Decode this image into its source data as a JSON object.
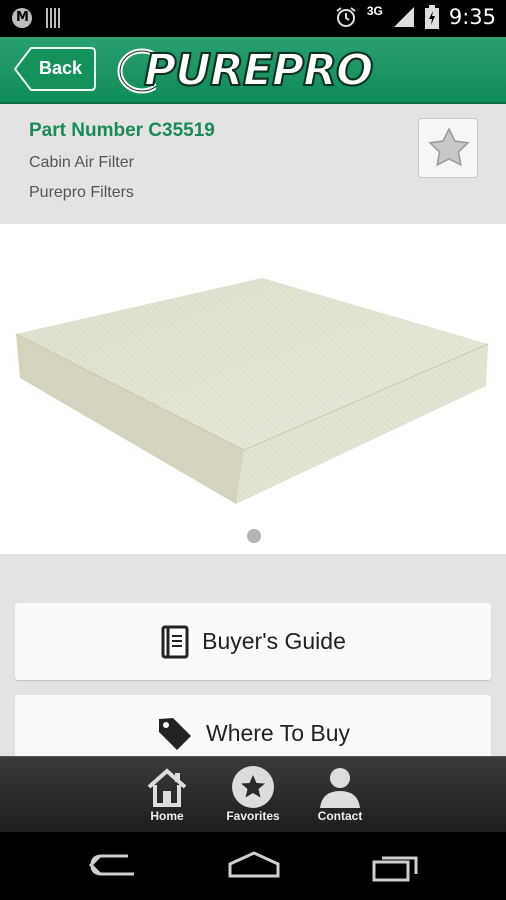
{
  "status_bar": {
    "network": "3G",
    "time": "9:35"
  },
  "header": {
    "back_label": "Back",
    "logo_text": "PUREPRO"
  },
  "product": {
    "part_number": "Part Number C35519",
    "category": "Cabin Air Filter",
    "brand": "Purepro Filters"
  },
  "actions": {
    "buyers_guide_label": "Buyer's Guide",
    "where_to_buy_label": "Where To Buy"
  },
  "tabs": [
    {
      "label": "Home",
      "icon": "home-icon"
    },
    {
      "label": "Favorites",
      "icon": "star-icon"
    },
    {
      "label": "Contact",
      "icon": "person-icon"
    }
  ],
  "colors": {
    "accent": "#1a8a57",
    "header": "#1a9a64"
  }
}
